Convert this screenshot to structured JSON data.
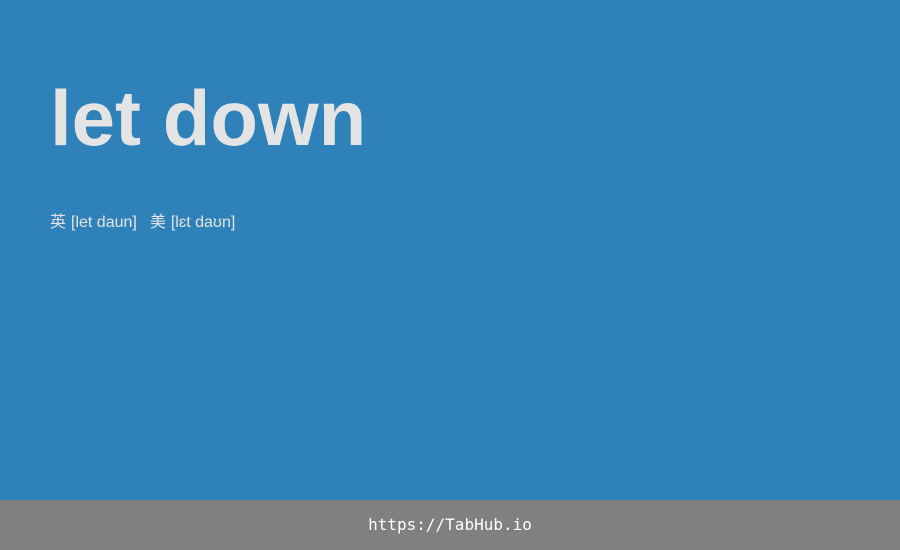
{
  "theme": {
    "background": "#2f81b9",
    "footer_background": "#808080",
    "text_color": "#e4e4e4",
    "footer_text_color": "#ffffff"
  },
  "word": "let down",
  "pronunciation": {
    "uk_label": "英",
    "uk_ipa": "[let daun]",
    "us_label": "美",
    "us_ipa": "[lɛt daʊn]"
  },
  "footer": {
    "link_text": "https://TabHub.io"
  }
}
